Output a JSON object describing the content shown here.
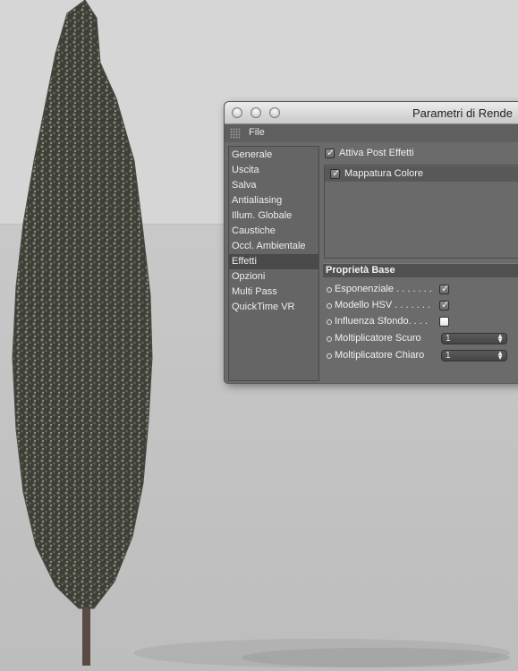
{
  "window": {
    "title": "Parametri di Rende",
    "buttons": [
      "close-button",
      "minimize-button",
      "zoom-button"
    ]
  },
  "menubar": {
    "file_label": "File"
  },
  "sidebar": {
    "items": [
      {
        "label": "Generale"
      },
      {
        "label": "Uscita"
      },
      {
        "label": "Salva"
      },
      {
        "label": "Antialiasing"
      },
      {
        "label": "Illum. Globale"
      },
      {
        "label": "Caustiche"
      },
      {
        "label": "Occl. Ambientale"
      },
      {
        "label": "Effetti",
        "selected": true
      },
      {
        "label": "Opzioni"
      },
      {
        "label": "Multi Pass"
      },
      {
        "label": "QuickTime VR"
      }
    ]
  },
  "effects": {
    "enable_label": "Attiva Post Effetti",
    "enable_checked": true,
    "list": [
      {
        "label": "Mappatura Colore",
        "checked": true
      }
    ]
  },
  "properties": {
    "section_title": "Proprietà Base",
    "rows": [
      {
        "label": "Esponenziale . . . . . . .",
        "type": "checkbox",
        "checked": true
      },
      {
        "label": "Modello HSV . . . . . . .",
        "type": "checkbox",
        "checked": true
      },
      {
        "label": "Influenza Sfondo. . . .",
        "type": "checkbox",
        "checked": false
      },
      {
        "label": "Moltiplicatore Scuro",
        "type": "number",
        "value": "1"
      },
      {
        "label": "Moltiplicatore Chiaro",
        "type": "number",
        "value": "1"
      }
    ]
  },
  "colors": {
    "panel": "#6b6b6b",
    "selection": "#4a4a4a",
    "section_header": "#505050",
    "viewport_background": "#d6d6d6"
  },
  "icons": {
    "checkmark": "checkmark-icon",
    "grip": "grip-icon",
    "stepper": "stepper-icon",
    "bullet": "bullet-icon"
  }
}
